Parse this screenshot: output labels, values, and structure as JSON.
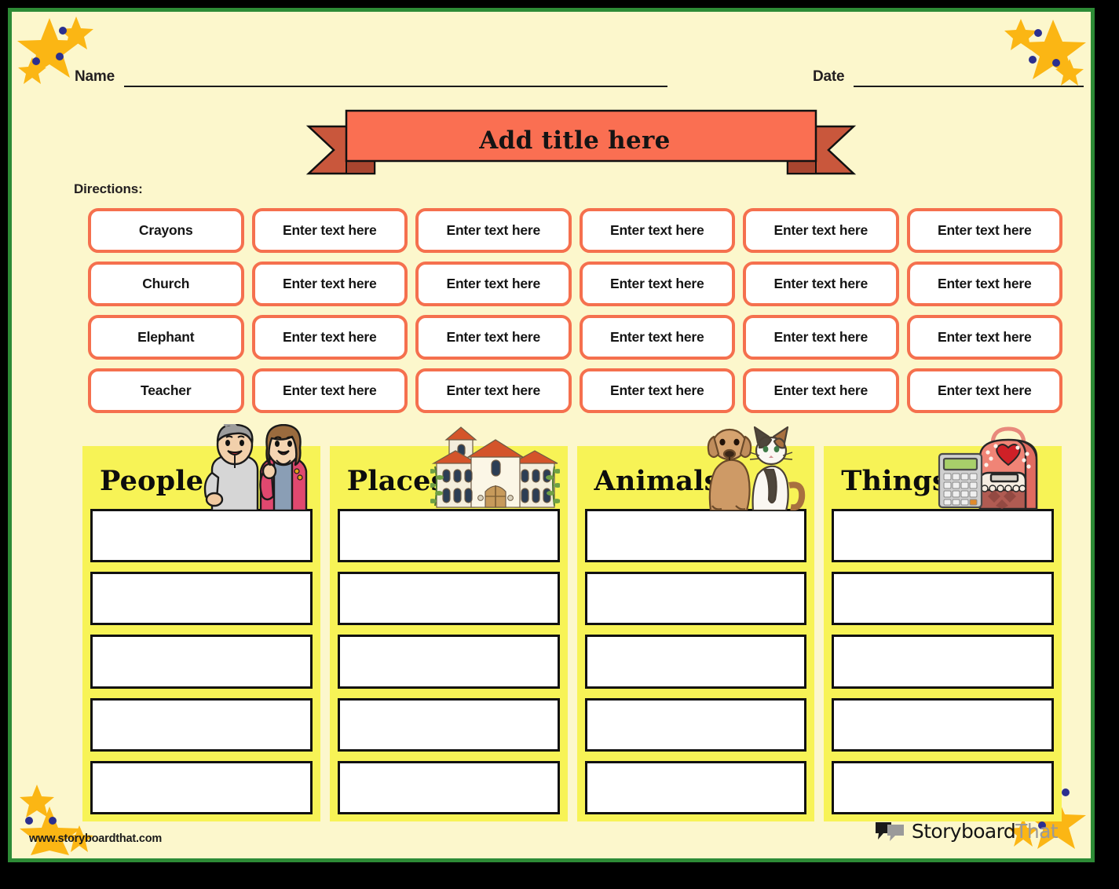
{
  "meta": {
    "name_label": "Name",
    "date_label": "Date",
    "name_value": "",
    "date_value": ""
  },
  "banner": {
    "title": "Add title here",
    "fill_color": "#FA6F52",
    "tail_color": "#C9573C"
  },
  "directions": {
    "label": "Directions:",
    "text": ""
  },
  "word_bank": {
    "rows": [
      [
        "Crayons",
        "Enter text here",
        "Enter text here",
        "Enter text here",
        "Enter text here",
        "Enter text here"
      ],
      [
        "Church",
        "Enter text here",
        "Enter text here",
        "Enter text here",
        "Enter text here",
        "Enter text here"
      ],
      [
        "Elephant",
        "Enter text here",
        "Enter text here",
        "Enter text here",
        "Enter text here",
        "Enter text here"
      ],
      [
        "Teacher",
        "Enter text here",
        "Enter text here",
        "Enter text here",
        "Enter text here",
        "Enter text here"
      ]
    ],
    "border_color": "#F5704E",
    "placeholder": "Enter text here"
  },
  "categories": [
    {
      "title": "People",
      "art": "people-illustration",
      "rows": [
        "",
        "",
        "",
        "",
        ""
      ]
    },
    {
      "title": "Places",
      "art": "house-illustration",
      "rows": [
        "",
        "",
        "",
        "",
        ""
      ]
    },
    {
      "title": "Animals",
      "art": "dog-cat-illustration",
      "rows": [
        "",
        "",
        "",
        "",
        ""
      ]
    },
    {
      "title": "Things",
      "art": "backpack-calculator-illustration",
      "rows": [
        "",
        "",
        "",
        "",
        ""
      ]
    }
  ],
  "footer": {
    "url": "www.storyboardthat.com",
    "brand_primary": "Storyboard",
    "brand_secondary": "That"
  },
  "theme": {
    "page_background": "#FCF7CC",
    "page_border": "#2D8B36",
    "panel_yellow": "#F7F356",
    "star_gold": "#FBB614",
    "star_dot_blue": "#2B2F8F",
    "accent_coral": "#F5704E"
  }
}
